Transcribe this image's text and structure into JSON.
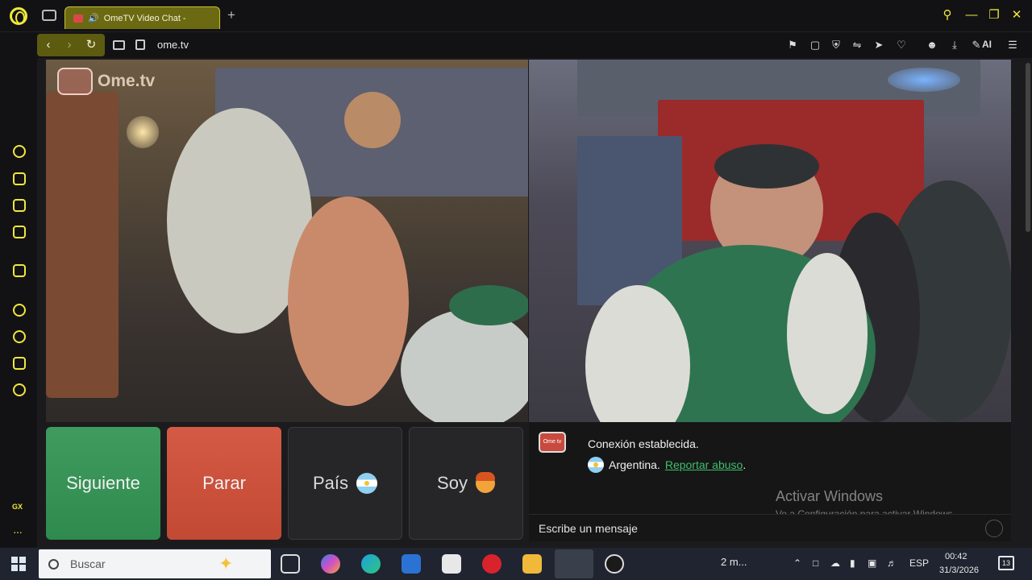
{
  "browser": {
    "tab_title": "OmeTV Video Chat -",
    "url": "ome.tv",
    "ai_label": "AI",
    "sidebar_gx_label": "GX",
    "sidebar_more": "···"
  },
  "video": {
    "watermark_text": "Ome.tv",
    "watermark_badge": "Ome tv"
  },
  "controls": {
    "next_label": "Siguiente",
    "stop_label": "Parar",
    "country_label": "País",
    "gender_label": "Soy"
  },
  "chat": {
    "logo_text": "Ome tv",
    "status": "Conexión establecida.",
    "country": "Argentina.",
    "report_link": "Reportar abuso",
    "report_suffix": ".",
    "input_placeholder": "Escribe un mensaje"
  },
  "watermark": {
    "title": "Activar Windows",
    "subtitle": "Ve a Configuración para activar Windows."
  },
  "taskbar": {
    "search_placeholder": "Buscar",
    "weather": "2 m...",
    "language": "ESP",
    "time": "00:42",
    "date": "31/3/2026",
    "notification_count": "13"
  }
}
